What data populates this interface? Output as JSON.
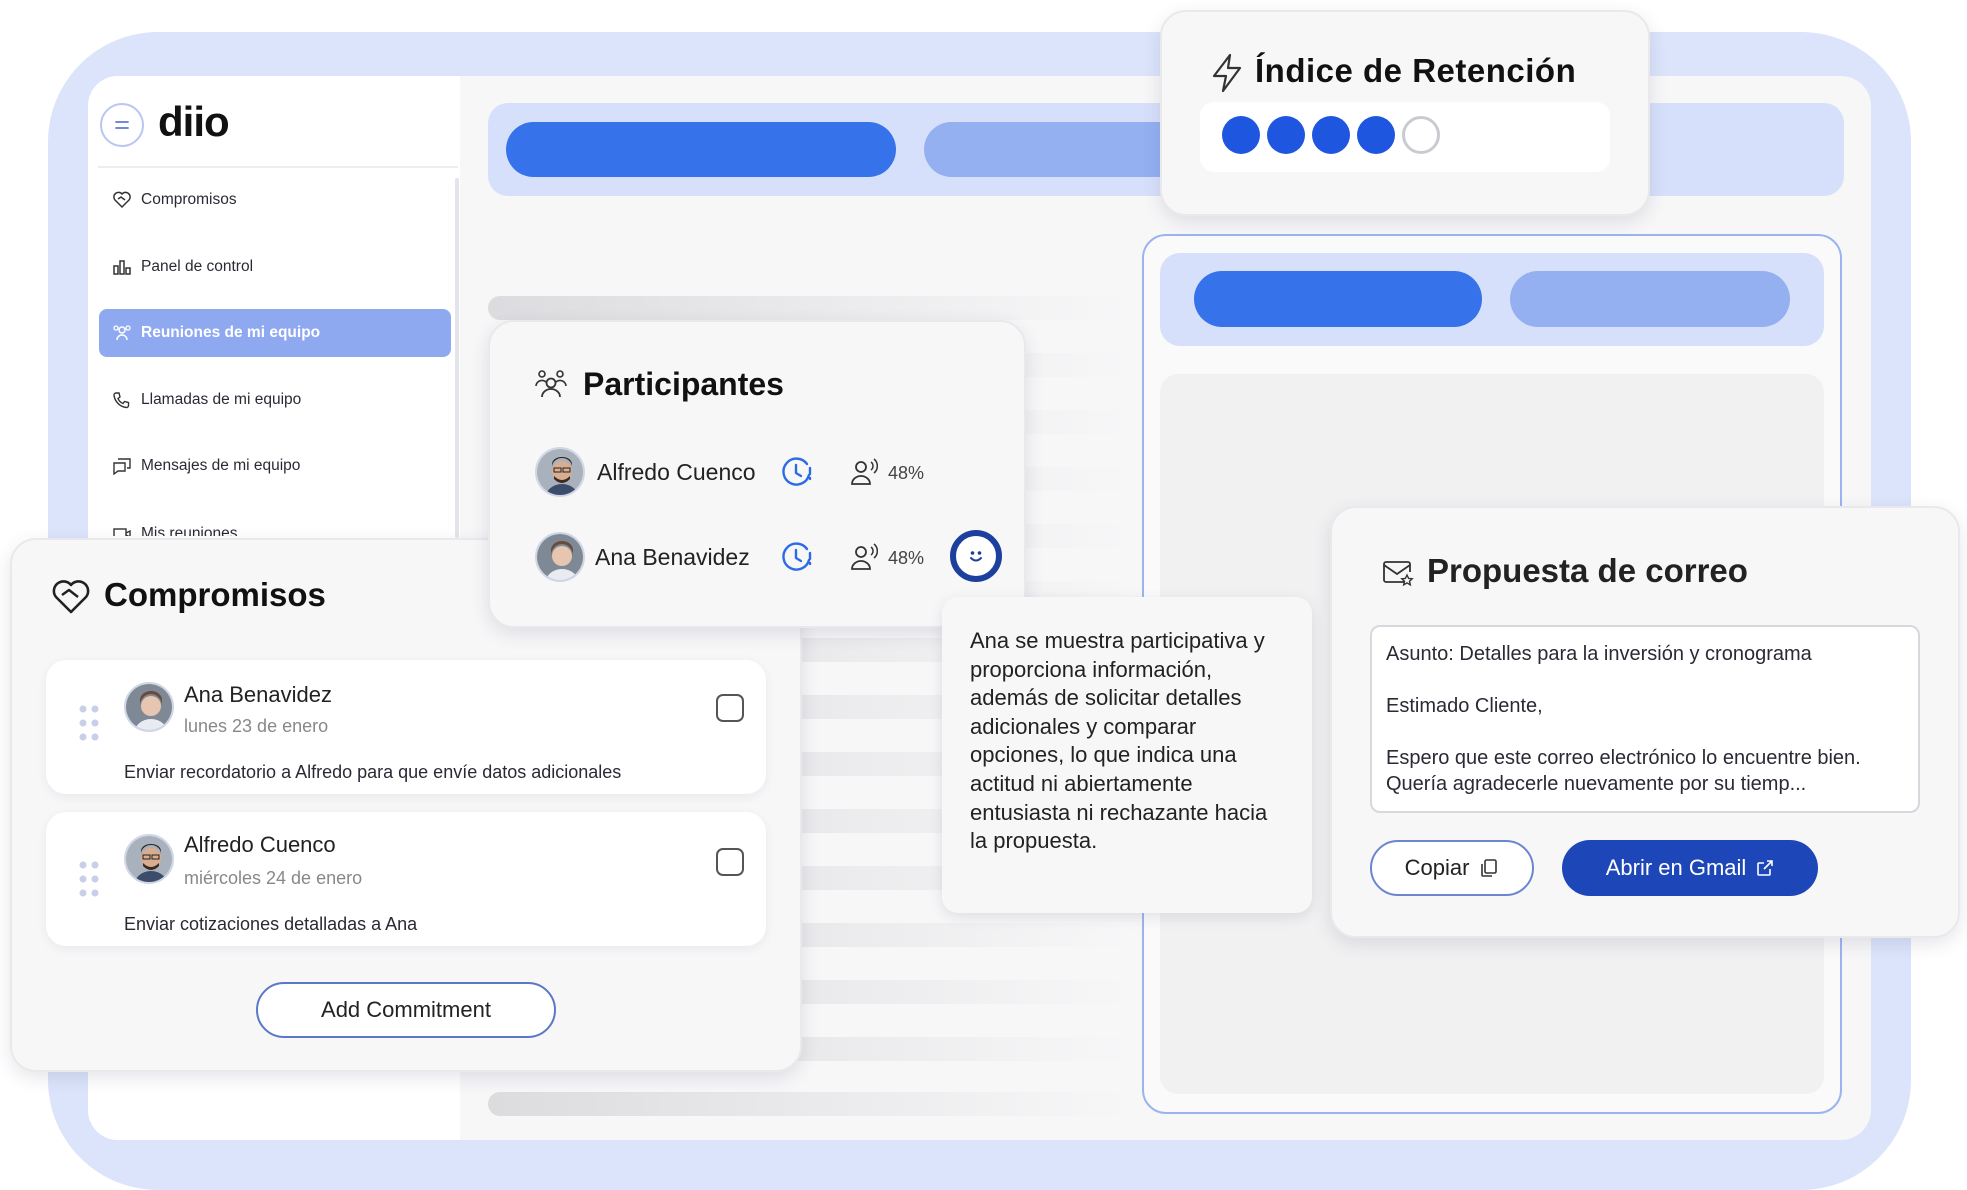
{
  "app": {
    "logo": "diio"
  },
  "sidebar": {
    "items": [
      {
        "label": "Compromisos",
        "icon": "handshake-icon"
      },
      {
        "label": "Panel de control",
        "icon": "bar-chart-icon"
      },
      {
        "label": "Reuniones de mi equipo",
        "icon": "team-icon",
        "active": true
      },
      {
        "label": "Llamadas de mi equipo",
        "icon": "phone-icon"
      },
      {
        "label": "Mensajes de mi equipo",
        "icon": "message-icon"
      },
      {
        "label": "Mis reuniones",
        "icon": "video-icon"
      }
    ]
  },
  "retention": {
    "title": "Índice de Retención",
    "score": 4,
    "max": 5
  },
  "participants": {
    "title": "Participantes",
    "rows": [
      {
        "name": "Alfredo Cuenco",
        "percent": "48%"
      },
      {
        "name": "Ana Benavidez",
        "percent": "48%"
      }
    ],
    "tooltip": "Ana se muestra participativa y proporciona información, además de solicitar detalles adicionales y comparar opciones, lo que indica una actitud ni abiertamente entusiasta ni rechazante hacia la propuesta."
  },
  "commitments": {
    "title": "Compromisos",
    "items": [
      {
        "name": "Ana Benavidez",
        "date": "lunes 23 de enero",
        "description": "Enviar recordatorio a Alfredo para que envíe datos adicionales",
        "checked": false
      },
      {
        "name": "Alfredo Cuenco",
        "date": "miércoles 24 de enero",
        "description": "Enviar cotizaciones detalladas a Ana",
        "checked": false
      }
    ],
    "add_label": "Add Commitment"
  },
  "email": {
    "title": "Propuesta de correo",
    "subject": "Asunto: Detalles para la inversión y cronograma",
    "greeting": "Estimado Cliente,",
    "body": "Espero que este correo electrónico lo encuentre bien. Quería agradecerle nuevamente por su tiemp...",
    "copy_label": "Copiar",
    "gmail_label": "Abrir en Gmail"
  },
  "colors": {
    "accent": "#3672ea",
    "accent_light": "#94b0f1",
    "dark_blue": "#1d47b8",
    "active_nav": "#8fa9f1"
  }
}
